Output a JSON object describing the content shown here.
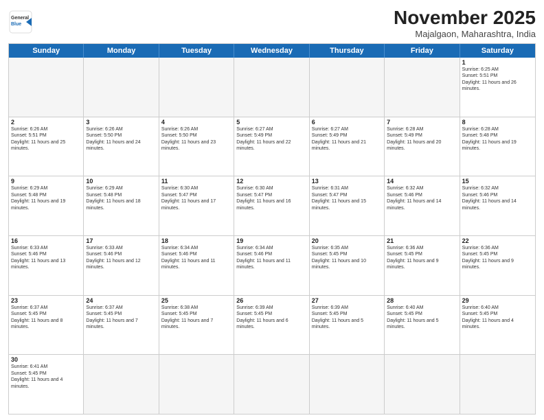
{
  "logo": {
    "general": "General",
    "blue": "Blue"
  },
  "title": {
    "month": "November 2025",
    "location": "Majalgaon, Maharashtra, India"
  },
  "header_days": [
    "Sunday",
    "Monday",
    "Tuesday",
    "Wednesday",
    "Thursday",
    "Friday",
    "Saturday"
  ],
  "weeks": [
    [
      {
        "day": "",
        "empty": true
      },
      {
        "day": "",
        "empty": true
      },
      {
        "day": "",
        "empty": true
      },
      {
        "day": "",
        "empty": true
      },
      {
        "day": "",
        "empty": true
      },
      {
        "day": "",
        "empty": true
      },
      {
        "day": "1",
        "sunrise": "Sunrise: 6:25 AM",
        "sunset": "Sunset: 5:51 PM",
        "daylight": "Daylight: 11 hours and 26 minutes."
      }
    ],
    [
      {
        "day": "2",
        "sunrise": "Sunrise: 6:26 AM",
        "sunset": "Sunset: 5:51 PM",
        "daylight": "Daylight: 11 hours and 25 minutes."
      },
      {
        "day": "3",
        "sunrise": "Sunrise: 6:26 AM",
        "sunset": "Sunset: 5:50 PM",
        "daylight": "Daylight: 11 hours and 24 minutes."
      },
      {
        "day": "4",
        "sunrise": "Sunrise: 6:26 AM",
        "sunset": "Sunset: 5:50 PM",
        "daylight": "Daylight: 11 hours and 23 minutes."
      },
      {
        "day": "5",
        "sunrise": "Sunrise: 6:27 AM",
        "sunset": "Sunset: 5:49 PM",
        "daylight": "Daylight: 11 hours and 22 minutes."
      },
      {
        "day": "6",
        "sunrise": "Sunrise: 6:27 AM",
        "sunset": "Sunset: 5:49 PM",
        "daylight": "Daylight: 11 hours and 21 minutes."
      },
      {
        "day": "7",
        "sunrise": "Sunrise: 6:28 AM",
        "sunset": "Sunset: 5:49 PM",
        "daylight": "Daylight: 11 hours and 20 minutes."
      },
      {
        "day": "8",
        "sunrise": "Sunrise: 6:28 AM",
        "sunset": "Sunset: 5:48 PM",
        "daylight": "Daylight: 11 hours and 19 minutes."
      }
    ],
    [
      {
        "day": "9",
        "sunrise": "Sunrise: 6:29 AM",
        "sunset": "Sunset: 5:48 PM",
        "daylight": "Daylight: 11 hours and 19 minutes."
      },
      {
        "day": "10",
        "sunrise": "Sunrise: 6:29 AM",
        "sunset": "Sunset: 5:48 PM",
        "daylight": "Daylight: 11 hours and 18 minutes."
      },
      {
        "day": "11",
        "sunrise": "Sunrise: 6:30 AM",
        "sunset": "Sunset: 5:47 PM",
        "daylight": "Daylight: 11 hours and 17 minutes."
      },
      {
        "day": "12",
        "sunrise": "Sunrise: 6:30 AM",
        "sunset": "Sunset: 5:47 PM",
        "daylight": "Daylight: 11 hours and 16 minutes."
      },
      {
        "day": "13",
        "sunrise": "Sunrise: 6:31 AM",
        "sunset": "Sunset: 5:47 PM",
        "daylight": "Daylight: 11 hours and 15 minutes."
      },
      {
        "day": "14",
        "sunrise": "Sunrise: 6:32 AM",
        "sunset": "Sunset: 5:46 PM",
        "daylight": "Daylight: 11 hours and 14 minutes."
      },
      {
        "day": "15",
        "sunrise": "Sunrise: 6:32 AM",
        "sunset": "Sunset: 5:46 PM",
        "daylight": "Daylight: 11 hours and 14 minutes."
      }
    ],
    [
      {
        "day": "16",
        "sunrise": "Sunrise: 6:33 AM",
        "sunset": "Sunset: 5:46 PM",
        "daylight": "Daylight: 11 hours and 13 minutes."
      },
      {
        "day": "17",
        "sunrise": "Sunrise: 6:33 AM",
        "sunset": "Sunset: 5:46 PM",
        "daylight": "Daylight: 11 hours and 12 minutes."
      },
      {
        "day": "18",
        "sunrise": "Sunrise: 6:34 AM",
        "sunset": "Sunset: 5:46 PM",
        "daylight": "Daylight: 11 hours and 11 minutes."
      },
      {
        "day": "19",
        "sunrise": "Sunrise: 6:34 AM",
        "sunset": "Sunset: 5:46 PM",
        "daylight": "Daylight: 11 hours and 11 minutes."
      },
      {
        "day": "20",
        "sunrise": "Sunrise: 6:35 AM",
        "sunset": "Sunset: 5:45 PM",
        "daylight": "Daylight: 11 hours and 10 minutes."
      },
      {
        "day": "21",
        "sunrise": "Sunrise: 6:36 AM",
        "sunset": "Sunset: 5:45 PM",
        "daylight": "Daylight: 11 hours and 9 minutes."
      },
      {
        "day": "22",
        "sunrise": "Sunrise: 6:36 AM",
        "sunset": "Sunset: 5:45 PM",
        "daylight": "Daylight: 11 hours and 9 minutes."
      }
    ],
    [
      {
        "day": "23",
        "sunrise": "Sunrise: 6:37 AM",
        "sunset": "Sunset: 5:45 PM",
        "daylight": "Daylight: 11 hours and 8 minutes."
      },
      {
        "day": "24",
        "sunrise": "Sunrise: 6:37 AM",
        "sunset": "Sunset: 5:45 PM",
        "daylight": "Daylight: 11 hours and 7 minutes."
      },
      {
        "day": "25",
        "sunrise": "Sunrise: 6:38 AM",
        "sunset": "Sunset: 5:45 PM",
        "daylight": "Daylight: 11 hours and 7 minutes."
      },
      {
        "day": "26",
        "sunrise": "Sunrise: 6:39 AM",
        "sunset": "Sunset: 5:45 PM",
        "daylight": "Daylight: 11 hours and 6 minutes."
      },
      {
        "day": "27",
        "sunrise": "Sunrise: 6:39 AM",
        "sunset": "Sunset: 5:45 PM",
        "daylight": "Daylight: 11 hours and 5 minutes."
      },
      {
        "day": "28",
        "sunrise": "Sunrise: 6:40 AM",
        "sunset": "Sunset: 5:45 PM",
        "daylight": "Daylight: 11 hours and 5 minutes."
      },
      {
        "day": "29",
        "sunrise": "Sunrise: 6:40 AM",
        "sunset": "Sunset: 5:45 PM",
        "daylight": "Daylight: 11 hours and 4 minutes."
      }
    ],
    [
      {
        "day": "30",
        "sunrise": "Sunrise: 6:41 AM",
        "sunset": "Sunset: 5:45 PM",
        "daylight": "Daylight: 11 hours and 4 minutes."
      },
      {
        "day": "",
        "empty": true
      },
      {
        "day": "",
        "empty": true
      },
      {
        "day": "",
        "empty": true
      },
      {
        "day": "",
        "empty": true
      },
      {
        "day": "",
        "empty": true
      },
      {
        "day": "",
        "empty": true
      }
    ]
  ]
}
